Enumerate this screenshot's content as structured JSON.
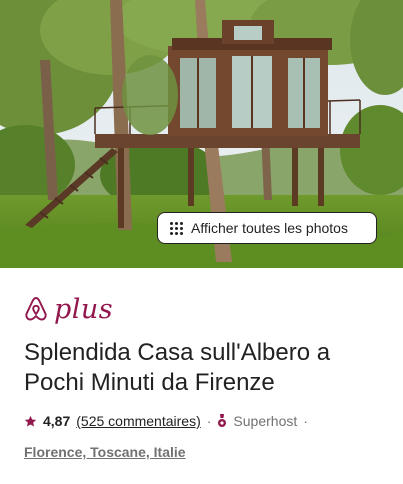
{
  "hero": {
    "photos_button_label": "Afficher toutes les photos",
    "photos_icon": "grid-dots-icon"
  },
  "brand": {
    "logo_icon": "airbnb-belo-icon",
    "plus_label": "plus",
    "color": "#92174d"
  },
  "listing": {
    "title": "Splendida Casa sull'Albero a Pochi Minuti da Firenze",
    "rating": "4,87",
    "reviews_label": "(525 commentaires)",
    "separator": "·",
    "superhost_icon": "superhost-medal-icon",
    "superhost_label": "Superhost",
    "location": "Florence, Toscane, Italie",
    "star_color": "#92174d"
  }
}
